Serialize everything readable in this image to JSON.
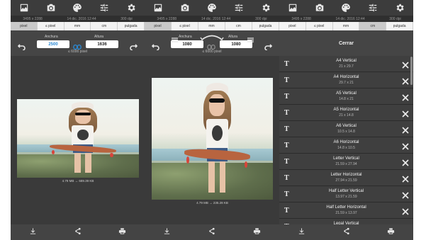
{
  "info": {
    "resolution": "3495 x 2288",
    "date": "14 dic. 2016 12:44",
    "dpi": "300 dpi"
  },
  "units": [
    "pixel",
    "≤ pixel",
    "mm",
    "cm",
    "pulgada"
  ],
  "panel1": {
    "width_label": "Anchura",
    "height_label": "Altura",
    "width_value": "2500",
    "height_value": "1636",
    "max_note": "≤ 6000 pixel",
    "size_caption": "4.79 MB → 689.39 KB",
    "selected_unit": 0
  },
  "panel2": {
    "width_label": "Anchura",
    "height_label": "Altura",
    "width_value": "1080",
    "height_value": "1080",
    "max_note": "≤ 6000 pixel",
    "size_caption": "4.79 MB → 235.28 KB",
    "selected_unit": 0
  },
  "panel3": {
    "close_label": "Cerrar",
    "selected_unit": 3,
    "presets": [
      {
        "name": "A4 Vertical",
        "size": "21 x 29.7"
      },
      {
        "name": "A4 Horizontal",
        "size": "29.7 x 21"
      },
      {
        "name": "A5 Vertical",
        "size": "14.8 x 21"
      },
      {
        "name": "A5 Horizontal",
        "size": "21 x 14.8"
      },
      {
        "name": "A6 Vertical",
        "size": "10.5 x 14.8"
      },
      {
        "name": "A6 Horizontal",
        "size": "14.8 x 10.5"
      },
      {
        "name": "Letter Vertical",
        "size": "21.59 x 27.94"
      },
      {
        "name": "Letter Horizontal",
        "size": "27.94 x 21.59"
      },
      {
        "name": "Half Letter Vertical",
        "size": "13.97 x 21.59"
      },
      {
        "name": "Half Letter Horizontal",
        "size": "21.59 x 13.97"
      },
      {
        "name": "Legal Vertical",
        "size": ""
      }
    ]
  },
  "icons": {
    "top": [
      "gallery-icon",
      "camera-icon",
      "palette-icon",
      "sliders-icon",
      "gear-icon"
    ],
    "bottom": [
      "download-icon",
      "share-icon",
      "print-icon"
    ]
  },
  "colors": {
    "accent": "#2a8ad6",
    "panel_bg": "#3a3a3a"
  }
}
